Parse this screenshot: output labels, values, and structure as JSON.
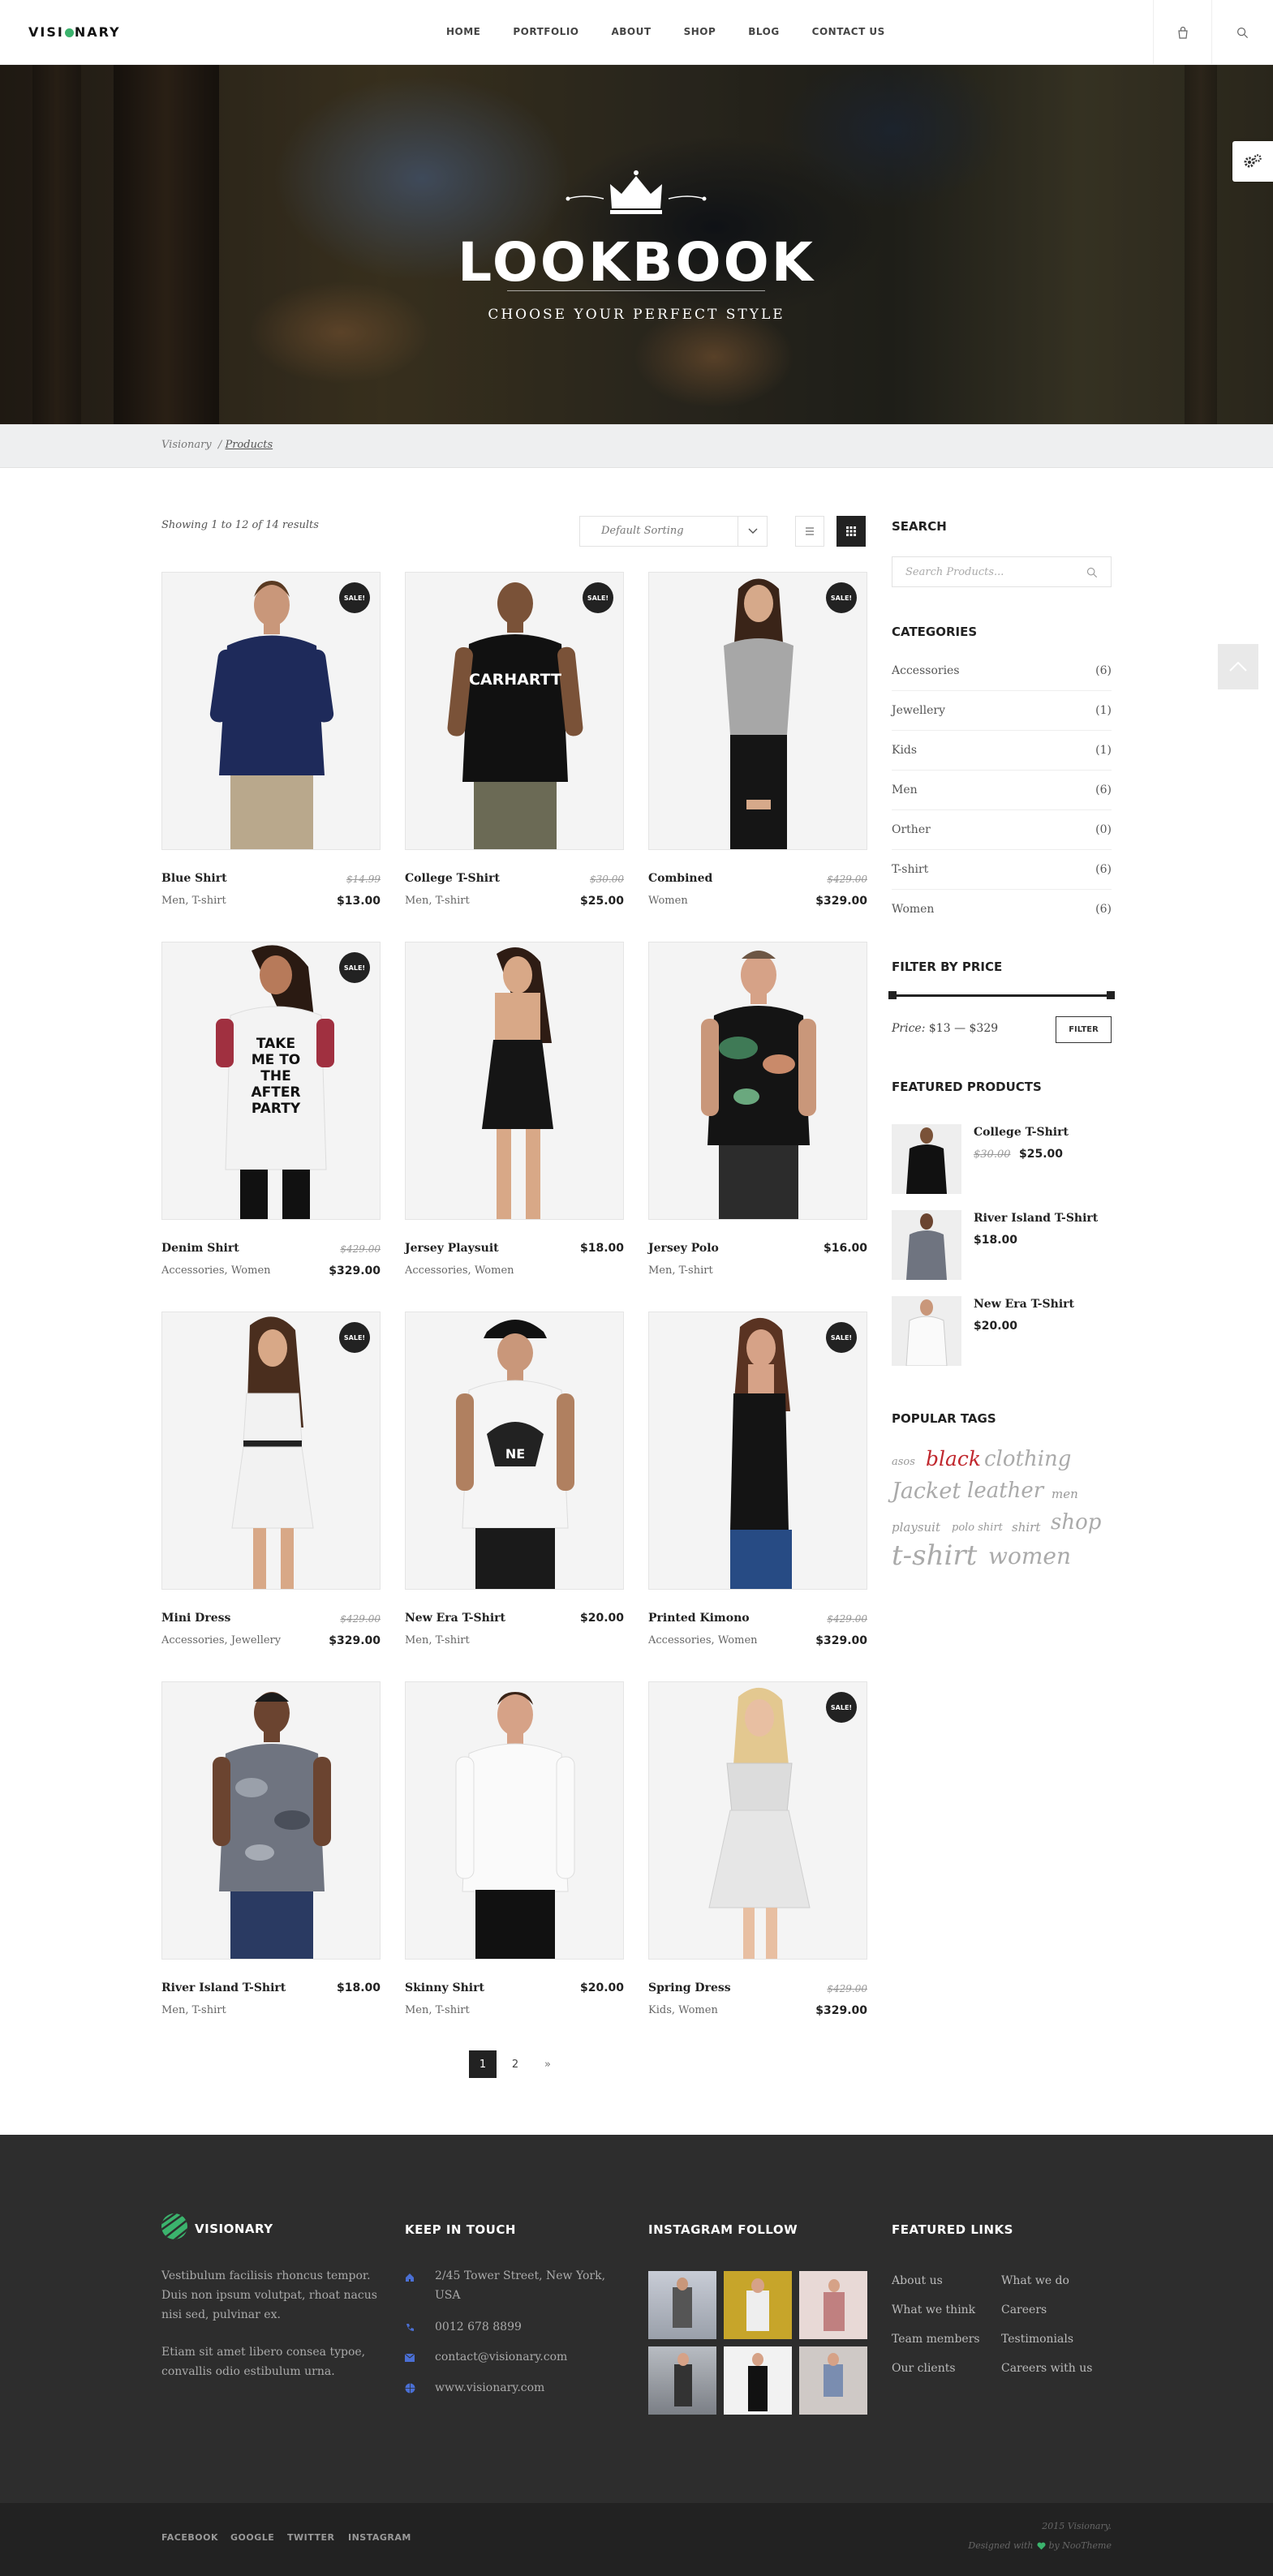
{
  "header": {
    "logo": "VISIONARY",
    "nav": [
      "HOME",
      "PORTFOLIO",
      "ABOUT",
      "SHOP",
      "BLOG",
      "CONTACT US"
    ],
    "icons": [
      "bag-icon",
      "search-icon"
    ]
  },
  "hero": {
    "title": "LOOKBOOK",
    "subtitle": "CHOOSE YOUR PERFECT STYLE",
    "icons": [
      "crown-icon",
      "settings-gear-icon"
    ]
  },
  "breadcrumb": {
    "home": "Visionary",
    "separator": "/",
    "current": "Products"
  },
  "toolbar": {
    "showing": "Showing 1 to 12 of 14 results",
    "sort_value": "Default Sorting",
    "view_icons": [
      "list-view-icon",
      "grid-view-icon"
    ]
  },
  "products": [
    {
      "name": "Blue Shirt",
      "cats": "Men, T-shirt",
      "old": "$14.99",
      "price": "$13.00",
      "sale": "SALE!"
    },
    {
      "name": "College T-Shirt",
      "cats": "Men, T-shirt",
      "old": "$30.00",
      "price": "$25.00",
      "sale": "SALE!"
    },
    {
      "name": "Combined",
      "cats": "Women",
      "old": "$429.00",
      "price": "$329.00",
      "sale": "SALE!"
    },
    {
      "name": "Denim Shirt",
      "cats": "Accessories, Women",
      "old": "$429.00",
      "price": "$329.00",
      "sale": "SALE!"
    },
    {
      "name": "Jersey Playsuit",
      "cats": "Accessories, Women",
      "old": "",
      "price": "$18.00",
      "sale": ""
    },
    {
      "name": "Jersey Polo",
      "cats": "Men, T-shirt",
      "old": "",
      "price": "$16.00",
      "sale": ""
    },
    {
      "name": "Mini Dress",
      "cats": "Accessories, Jewellery",
      "old": "$429.00",
      "price": "$329.00",
      "sale": "SALE!"
    },
    {
      "name": "New Era T-Shirt",
      "cats": "Men, T-shirt",
      "old": "",
      "price": "$20.00",
      "sale": ""
    },
    {
      "name": "Printed Kimono",
      "cats": "Accessories, Women",
      "old": "$429.00",
      "price": "$329.00",
      "sale": "SALE!"
    },
    {
      "name": "River Island T-Shirt",
      "cats": "Men, T-shirt",
      "old": "",
      "price": "$18.00",
      "sale": ""
    },
    {
      "name": "Skinny Shirt",
      "cats": "Men, T-shirt",
      "old": "",
      "price": "$20.00",
      "sale": ""
    },
    {
      "name": "Spring Dress",
      "cats": "Kids, Women",
      "old": "$429.00",
      "price": "$329.00",
      "sale": "SALE!"
    }
  ],
  "shirt_prints": {
    "college": "CARHARTT",
    "denim": [
      "TAKE",
      "ME TO",
      "THE",
      "AFTER",
      "PARTY"
    ],
    "newera": "NE"
  },
  "pagination": {
    "pages": [
      "1",
      "2"
    ],
    "next": "»",
    "active": "1"
  },
  "sidebar": {
    "search_title": "SEARCH",
    "search_placeholder": "Search Products...",
    "categories_title": "CATEGORIES",
    "categories": [
      {
        "name": "Accessories",
        "count": "(6)"
      },
      {
        "name": "Jewellery",
        "count": "(1)"
      },
      {
        "name": "Kids",
        "count": "(1)"
      },
      {
        "name": "Men",
        "count": "(6)"
      },
      {
        "name": "Orther",
        "count": "(0)"
      },
      {
        "name": "T-shirt",
        "count": "(6)"
      },
      {
        "name": "Women",
        "count": "(6)"
      }
    ],
    "filter_title": "FILTER BY PRICE",
    "price_label": "Price:",
    "price_range": "$13 — $329",
    "filter_button": "FILTER",
    "featured_title": "FEATURED PRODUCTS",
    "featured": [
      {
        "name": "College T-Shirt",
        "old": "$30.00",
        "price": "$25.00"
      },
      {
        "name": "River Island T-Shirt",
        "old": "",
        "price": "$18.00"
      },
      {
        "name": "New Era T-Shirt",
        "old": "",
        "price": "$20.00"
      }
    ],
    "tags_title": "POPULAR TAGS",
    "tags": [
      "asos",
      "black",
      "clothing",
      "Jacket",
      "leather",
      "men",
      "playsuit",
      "polo shirt",
      "shirt",
      "shop",
      "t-shirt",
      "women"
    ],
    "tag_accent": "#c0272d"
  },
  "footer": {
    "brand": "VISIONARY",
    "about1": "Vestibulum facilisis rhoncus tempor. Duis non ipsum volutpat, rhoat nacus nisi sed, pulvinar ex.",
    "about2": "Etiam sit amet libero consea typoe, convallis odio estibulum urna.",
    "keep_title": "KEEP IN TOUCH",
    "address": "2/45 Tower Street, New York, USA",
    "phone": "0012 678 8899",
    "email": "contact@visionary.com",
    "web": "www.visionary.com",
    "contact_icons": [
      "home-icon",
      "phone-icon",
      "mail-icon",
      "globe-icon"
    ],
    "insta_title": "INSTAGRAM FOLLOW",
    "links_title": "FEATURED LINKS",
    "links_col1": [
      "About us",
      "What we think",
      "Team members",
      "Our clients"
    ],
    "links_col2": [
      "What we do",
      "Careers",
      "Testimonials",
      "Careers with us"
    ],
    "social": [
      "FACEBOOK",
      "GOOGLE",
      "TWITTER",
      "INSTAGRAM"
    ],
    "copy": "2015 Visionary.",
    "designed_pre": "Designed with",
    "designed_post": "by NooTheme",
    "accent": "#3bb36d"
  },
  "colors": {
    "brand_green": "#3bb36d",
    "dark": "#222222",
    "footer_bg": "#2d2d2d"
  }
}
